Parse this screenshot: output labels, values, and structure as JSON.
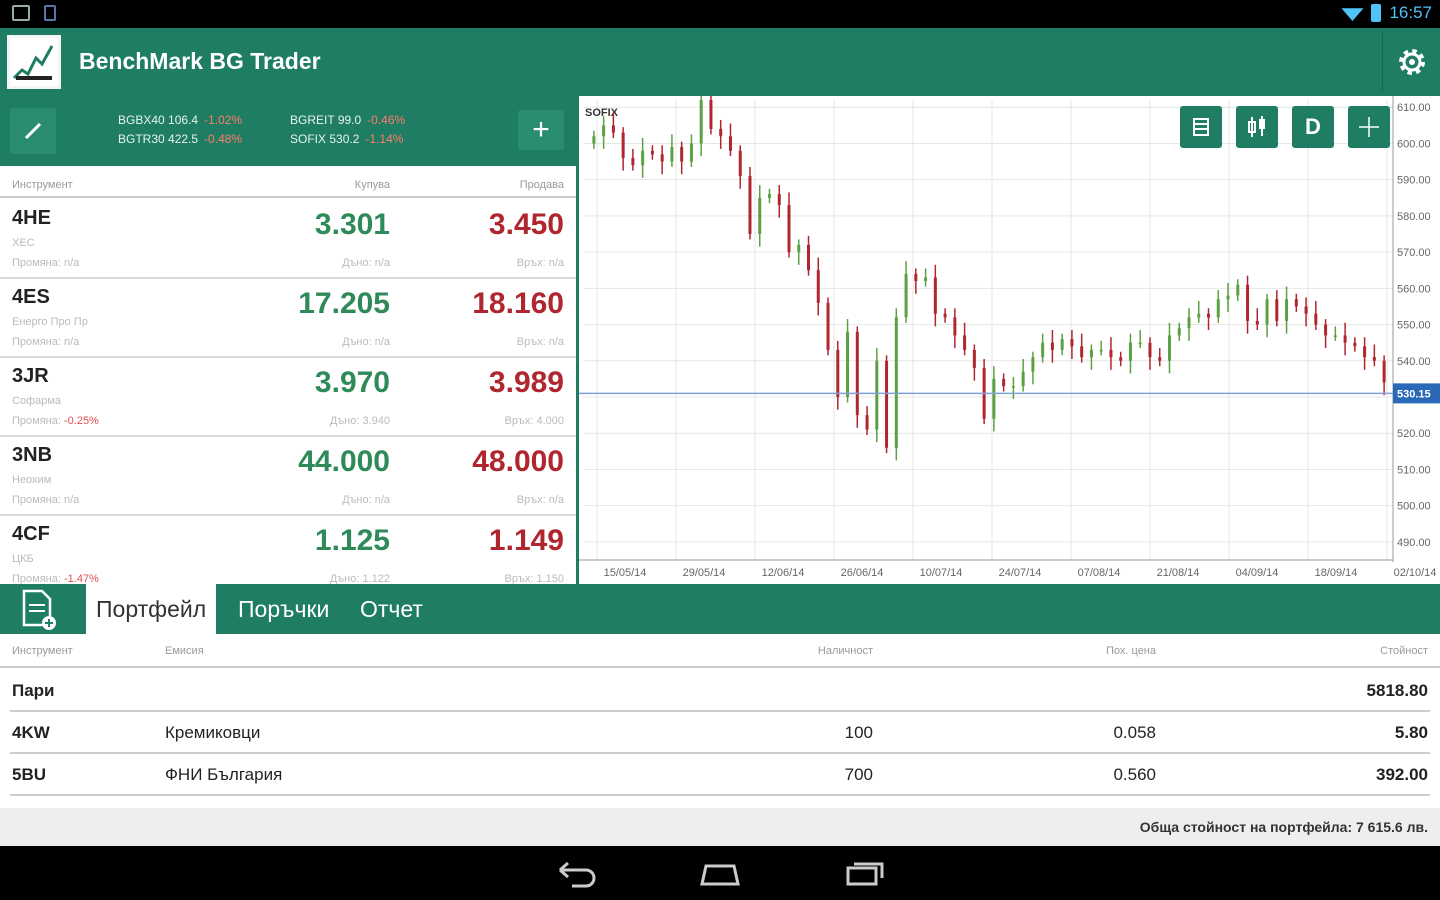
{
  "status_bar": {
    "time": "16:57"
  },
  "app": {
    "title": "BenchMark BG Trader"
  },
  "tickers": [
    {
      "name": "BGBX40",
      "value": "106.4",
      "change": "-1.02%"
    },
    {
      "name": "BGREIT",
      "value": "99.0",
      "change": "-0.46%"
    },
    {
      "name": "BGTR30",
      "value": "422.5",
      "change": "-0.48%"
    },
    {
      "name": "SOFIX",
      "value": "530.2",
      "change": "-1.14%"
    }
  ],
  "watchlist": {
    "headers": {
      "instrument": "Инструмент",
      "buy": "Купува",
      "sell": "Продава"
    },
    "rows": [
      {
        "symbol": "4HE",
        "name": "ХЕС",
        "change_label": "Промяна:",
        "change": "n/a",
        "buy": "3.301",
        "sell": "3.450",
        "low": "Дъно: n/a",
        "high": "Връх: n/a"
      },
      {
        "symbol": "4ES",
        "name": "Енерго Про Пр",
        "change_label": "Промяна:",
        "change": "n/a",
        "buy": "17.205",
        "sell": "18.160",
        "low": "Дъно: n/a",
        "high": "Връх: n/a"
      },
      {
        "symbol": "3JR",
        "name": "Софарма",
        "change_label": "Промяна:",
        "change": "-0.25%",
        "buy": "3.970",
        "sell": "3.989",
        "low": "Дъно: 3.940",
        "high": "Връх: 4.000"
      },
      {
        "symbol": "3NB",
        "name": "Неохим",
        "change_label": "Промяна:",
        "change": "n/a",
        "buy": "44.000",
        "sell": "48.000",
        "low": "Дъно: n/a",
        "high": "Връх: n/a"
      },
      {
        "symbol": "4CF",
        "name": "ЦКБ",
        "change_label": "Промяна:",
        "change": "-1.47%",
        "buy": "1.125",
        "sell": "1.149",
        "low": "Дъно: 1.122",
        "high": "Връх: 1.150"
      }
    ]
  },
  "chart_tools": {
    "period": "D"
  },
  "chart_data": {
    "type": "candlestick",
    "title": "SOFIX",
    "ylim": [
      485,
      612
    ],
    "yticks": [
      "610.00",
      "600.00",
      "590.00",
      "580.00",
      "570.00",
      "560.00",
      "550.00",
      "540.00",
      "530.00",
      "520.00",
      "510.00",
      "500.00",
      "490.00"
    ],
    "ytick_values": [
      610,
      600,
      590,
      580,
      570,
      560,
      550,
      540,
      530,
      520,
      510,
      500,
      490
    ],
    "xticks": [
      "15/05/14",
      "29/05/14",
      "12/06/14",
      "26/06/14",
      "10/07/14",
      "24/07/14",
      "07/08/14",
      "21/08/14",
      "04/09/14",
      "18/09/14",
      "02/10/14"
    ],
    "current_value": 531,
    "current_label": "530.15",
    "closes": [
      602,
      605,
      603,
      596,
      594,
      598,
      597,
      595,
      599,
      595,
      600,
      612,
      604,
      602,
      598,
      591,
      575,
      585,
      586,
      583,
      570,
      572,
      565,
      556,
      543,
      530,
      548,
      525,
      521,
      540,
      516,
      552,
      564,
      562,
      563,
      553,
      552,
      547,
      543,
      538,
      524,
      535,
      533,
      533,
      537,
      541,
      545,
      543,
      546,
      544,
      541,
      543,
      543,
      541,
      540,
      545,
      545,
      541,
      540,
      547,
      549,
      552,
      553,
      552,
      557,
      558,
      561,
      551,
      550,
      557,
      551,
      557,
      555,
      553,
      550,
      547,
      547,
      545,
      544,
      541,
      540,
      534
    ]
  },
  "tabs": [
    {
      "label": "Портфейл",
      "active": true
    },
    {
      "label": "Поръчки",
      "active": false
    },
    {
      "label": "Отчет",
      "active": false
    }
  ],
  "portfolio": {
    "headers": {
      "instrument": "Инструмент",
      "issue": "Емисия",
      "quantity": "Наличност",
      "price": "Пох. цена",
      "value": "Стойност"
    },
    "cash_label": "Пари",
    "cash_value": "5818.80",
    "rows": [
      {
        "symbol": "4KW",
        "name": "Кремиковци",
        "quantity": "100",
        "price": "0.058",
        "value": "5.80"
      },
      {
        "symbol": "5BU",
        "name": "ФНИ България",
        "quantity": "700",
        "price": "0.560",
        "value": "392.00"
      }
    ],
    "total": "Обща стойност на портфейла: 7 615.6 лв."
  },
  "colors": {
    "accent": "#1e7d62",
    "up": "#5aa144",
    "down": "#b0262e",
    "cursor_line": "#7f9fd6"
  }
}
